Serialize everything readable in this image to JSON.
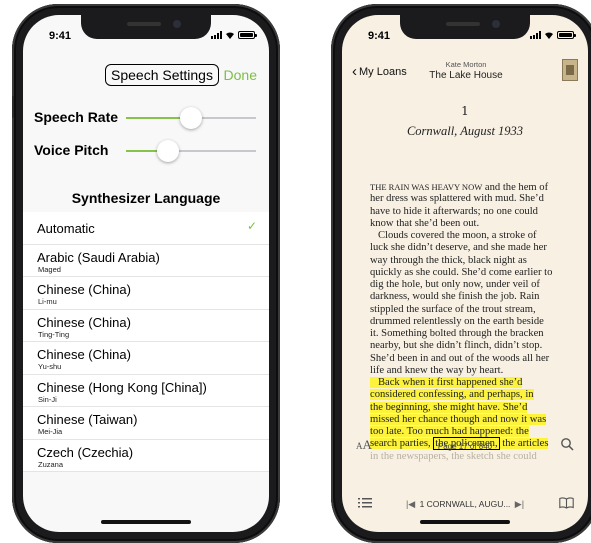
{
  "left_screen": {
    "status_time": "9:41",
    "title": "Speech Settings",
    "done_label": "Done",
    "speech_rate": {
      "label": "Speech Rate",
      "value": 0.5
    },
    "voice_pitch": {
      "label": "Voice Pitch",
      "value": 0.32
    },
    "section_header": "Synthesizer Language",
    "languages": [
      {
        "name": "Automatic",
        "voice": "",
        "selected": true
      },
      {
        "name": "Arabic (Saudi Arabia)",
        "voice": "Maged"
      },
      {
        "name": "Chinese (China)",
        "voice": "Li-mu"
      },
      {
        "name": "Chinese (China)",
        "voice": "Ting-Ting"
      },
      {
        "name": "Chinese (China)",
        "voice": "Yu-shu"
      },
      {
        "name": "Chinese (Hong Kong [China])",
        "voice": "Sin-Ji"
      },
      {
        "name": "Chinese (Taiwan)",
        "voice": "Mei-Jia"
      },
      {
        "name": "Czech (Czechia)",
        "voice": "Zuzana"
      }
    ],
    "checkmark_icon": "✓",
    "accent_color": "#7ac143"
  },
  "right_screen": {
    "status_time": "9:41",
    "back_label": "My Loans",
    "author": "Kate Morton",
    "book_title": "The Lake House",
    "chapter_number": "1",
    "chapter_title": "Cornwall, August 1933",
    "text_lines": [
      {
        "sc": "THE RAIN WAS HEAVY NOW",
        "text": " and the hem of"
      },
      {
        "text": "her dress was splattered with mud. She’d"
      },
      {
        "text": "have to hide it afterwards; no one could"
      },
      {
        "text": "know that she’d been out."
      },
      {
        "text": "   Clouds covered the moon, a stroke of"
      },
      {
        "text": "luck she didn’t deserve, and she made her"
      },
      {
        "text": "way through the thick, black night as"
      },
      {
        "text": "quickly as she could. She’d come earlier to"
      },
      {
        "text": "dig the hole, but only now, under veil of"
      },
      {
        "text": "darkness, would she finish the job. Rain"
      },
      {
        "text": "stippled the surface of the trout stream,"
      },
      {
        "text": "drummed relentlessly on the earth beside"
      },
      {
        "text": "it. Something bolted through the bracken"
      },
      {
        "text": "nearby, but she didn’t flinch, didn’t stop."
      },
      {
        "text": "She’d been in and out of the woods all her"
      },
      {
        "text": "life and knew the way by heart."
      },
      {
        "text": "   Back when it first happened she’d",
        "highlight": true
      },
      {
        "text": "considered confessing, and perhaps, in",
        "highlight": true
      },
      {
        "text": "the beginning, she might have. She’d",
        "highlight": true
      },
      {
        "text": "missed her chance though and now it was",
        "highlight": true
      },
      {
        "text": "too late. Too much had happened: the",
        "highlight": true
      },
      {
        "pre": "search parties, ",
        "boxed": "the policemen,",
        "post": " the articles",
        "highlight": true
      },
      {
        "text": "in the newspapers, the sketch she could",
        "faded": true
      }
    ],
    "page_indicator": "Page 17 of 840",
    "chapter_nav": "1 CORNWALL, AUGU...",
    "highlight_color": "#fcf33a"
  }
}
